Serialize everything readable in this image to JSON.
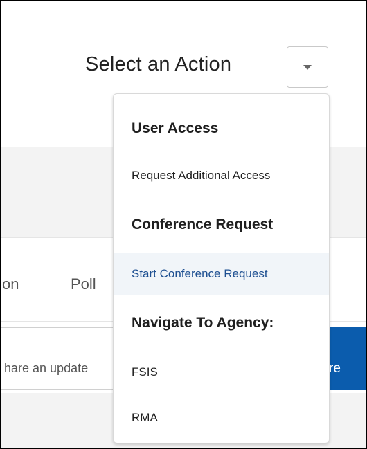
{
  "header": {
    "select_label": "Select an Action",
    "dropdown_icon": "chevron-down-icon"
  },
  "background": {
    "tabs": [
      {
        "label": "on"
      },
      {
        "label": "Poll"
      }
    ],
    "share_input_text": "hare an update",
    "share_button_label": "re",
    "accent_color": "#0b5cad"
  },
  "menu": {
    "sections": [
      {
        "heading": "User Access",
        "items": [
          "Request Additional Access"
        ]
      },
      {
        "heading": "Conference Request",
        "items": [
          "Start Conference Request"
        ]
      },
      {
        "heading": "Navigate To Agency:",
        "items": [
          "FSIS",
          "RMA"
        ]
      }
    ],
    "highlighted_item": "Start Conference Request",
    "highlight_color": "#f1f5f9"
  }
}
